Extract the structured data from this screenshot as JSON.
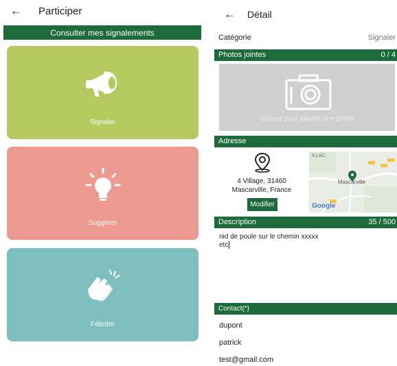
{
  "left": {
    "title": "Participer",
    "consult_label": "Consulter mes signalements",
    "cards": [
      {
        "label": "Signaler",
        "color": "#b5c95e",
        "icon": "megaphone-icon"
      },
      {
        "label": "Suggérer",
        "color": "#ed9990",
        "icon": "lightbulb-icon"
      },
      {
        "label": "Féliciter",
        "color": "#7dbfbe",
        "icon": "clapping-hands-icon"
      }
    ]
  },
  "right": {
    "title": "Détail",
    "category_label": "Catégorie",
    "category_value": "Signaler",
    "photos_label": "Photos jointes",
    "photos_count": "0 / 4",
    "photo_hint": "Cliquer pour ajouter une photo",
    "address_label": "Adresse",
    "address_line1": "4 Village, 31460",
    "address_line2": "Mascarville, France",
    "modify_label": "Modifier",
    "map_label_top": "ILLAC",
    "map_town": "Mascarville",
    "map_brand": "Google",
    "description_label": "Description",
    "description_count": "35 / 500",
    "description_text_line1": "nid de poule sur le chemin xxxxx",
    "description_text_line2": "etc",
    "contact_label": "Contact(*)",
    "contact_lastname": "dupont",
    "contact_firstname": "patrick",
    "contact_email": "test@gmail.com"
  },
  "colors": {
    "green": "#1d6b3b",
    "signaler": "#b5c95e",
    "suggerer": "#ed9990",
    "feliciter": "#7dbfbe",
    "photo_bg": "#cfcfcf"
  }
}
